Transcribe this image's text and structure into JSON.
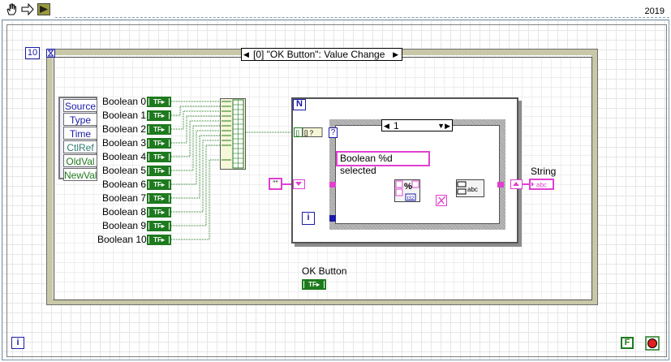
{
  "toolbar": {
    "version": "2019",
    "icons": [
      "hand-icon",
      "arrow-icon",
      "run-icon"
    ]
  },
  "event_structure": {
    "timeout_value": "10",
    "selector": "[0] \"OK Button\": Value Change",
    "event_data": [
      "Source",
      "Type",
      "Time",
      "CtlRef",
      "OldVal",
      "NewVal"
    ]
  },
  "booleans": [
    "Boolean 0",
    "Boolean 1",
    "Boolean 2",
    "Boolean 3",
    "Boolean 4",
    "Boolean 5",
    "Boolean 6",
    "Boolean 7",
    "Boolean 8",
    "Boolean 9",
    "Boolean 10"
  ],
  "for_loop": {
    "count_label": "N",
    "iteration_label": "i",
    "case_selector": "1",
    "search_const": "?",
    "format_string": "Boolean %d selected",
    "empty_string": "\"\""
  },
  "outputs": {
    "string_label": "String",
    "ok_button_label": "OK Button"
  },
  "bottom": {
    "iteration_label": "i",
    "stop_const": "F"
  },
  "colors": {
    "boolean_wire": "#1e7a1e",
    "string_wire": "#e040d0",
    "numeric_wire": "#1a1aa6"
  }
}
